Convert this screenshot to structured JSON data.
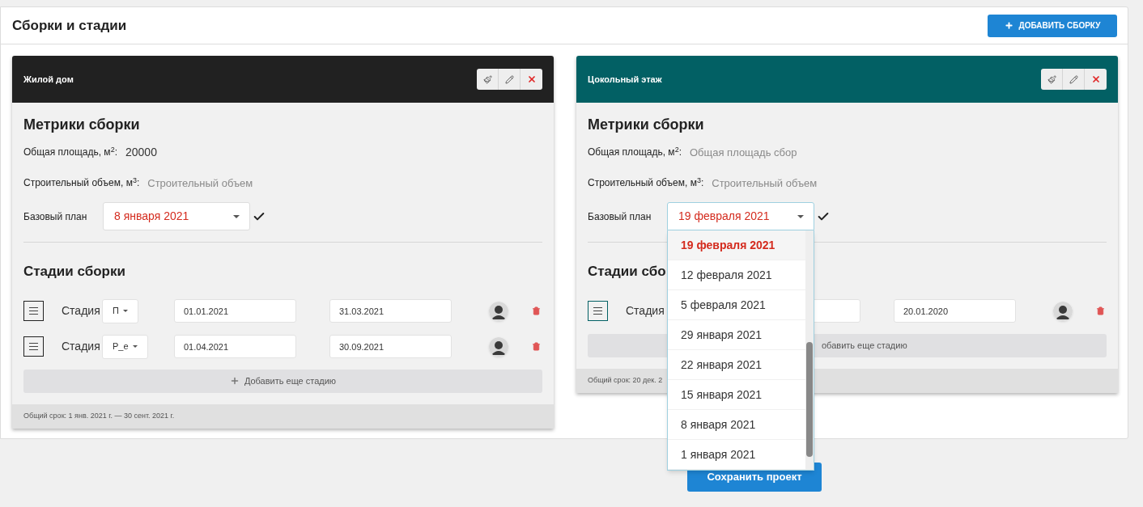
{
  "title": "Сборки и стадии",
  "add_button": {
    "label": "ДОБАВИТЬ СБОРКУ"
  },
  "builds": [
    {
      "name": "Жилой дом",
      "color": "#212121",
      "metrics_title": "Метрики сборки",
      "metrics": [
        {
          "label": "Общая площадь, м$^{2}$:",
          "value": "20000"
        },
        {
          "label": "Строительный объем, м$^{3}$:",
          "placeholder": "Строительный объем"
        }
      ],
      "base_plan": {
        "label": "Базовый план",
        "value": "8 января 2021",
        "expanded": false
      },
      "stages_title": "Стадии сборки",
      "stages": [
        {
          "label": "Стадия",
          "type": "П",
          "start": "01.01.2021",
          "end": "31.03.2021"
        },
        {
          "label": "Стадия",
          "type": "Р_е",
          "start": "01.04.2021",
          "end": "30.09.2021"
        }
      ],
      "add_stage": "Добавить еще стадию",
      "summary": "Общий срок: 1 янв. 2021 г. — 30 сент. 2021 г."
    },
    {
      "name": "Цокольный этаж",
      "color": "#026064",
      "metrics_title": "Метрики сборки",
      "metrics": [
        {
          "label": "Общая площадь, м$^{2}$:",
          "placeholder": "Общая площадь сбор"
        },
        {
          "label": "Строительный объем, м$^{3}$:",
          "placeholder": "Строительный объем"
        }
      ],
      "base_plan": {
        "label": "Базовый план",
        "value": "19 февраля 2021",
        "expanded": true,
        "options": [
          {
            "label": "19 февраля 2021",
            "selected": true
          },
          {
            "label": "12 февраля 2021",
            "selected": false
          },
          {
            "label": "5 февраля 2021",
            "selected": false
          },
          {
            "label": "29 января 2021",
            "selected": false
          },
          {
            "label": "22 января 2021",
            "selected": false
          },
          {
            "label": "15 января 2021",
            "selected": false
          },
          {
            "label": "8 января 2021",
            "selected": false
          },
          {
            "label": "1 января 2021",
            "selected": false
          }
        ]
      },
      "stages_title": "Стадии сбо",
      "stages": [
        {
          "label": "Стадия",
          "end": "20.01.2020"
        }
      ],
      "add_stage": "обавить еще стадию",
      "summary": "Общий срок: 20 дек. 2"
    }
  ],
  "save_button": {
    "label": "Сохранить проект"
  }
}
